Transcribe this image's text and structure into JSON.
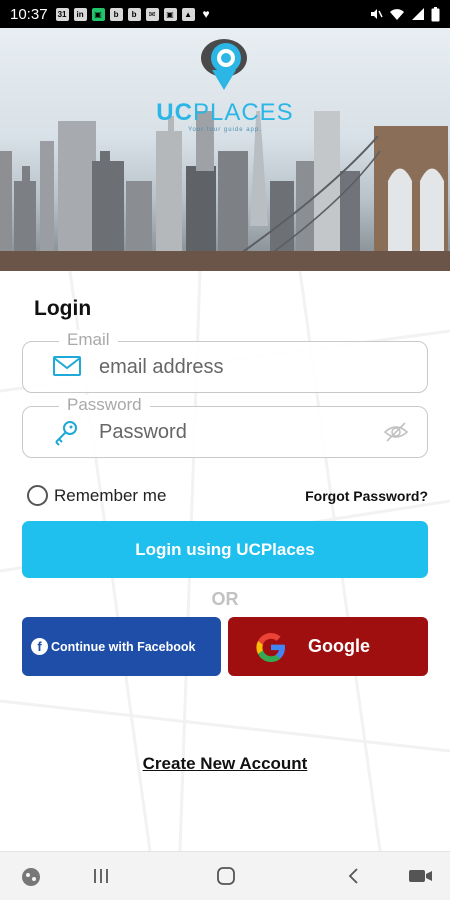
{
  "status_bar": {
    "time": "10:37",
    "notification_icons": [
      "31",
      "in",
      "▣",
      "b",
      "b",
      "✉",
      "▣",
      "▲",
      "♥"
    ]
  },
  "brand": {
    "name_bold": "UC",
    "name_light": "PLACES",
    "tagline": "Your tour guide app.",
    "accent_color": "#1fbfee"
  },
  "login": {
    "title": "Login",
    "email": {
      "legend": "Email",
      "placeholder": "email address",
      "icon": "envelope-icon"
    },
    "password": {
      "legend": "Password",
      "placeholder": "Password",
      "icon": "key-icon",
      "toggle_icon": "eye-off-icon"
    },
    "remember_label": "Remember me",
    "forgot_label": "Forgot Password?",
    "primary_button": "Login using UCPlaces",
    "divider": "OR",
    "facebook_button": "Continue with Facebook",
    "google_button": "Google",
    "create_account": "Create New Account"
  },
  "colors": {
    "facebook": "#1f4ea9",
    "google": "#a00f0f"
  },
  "nav_bar": {
    "icons": [
      "dots-icon",
      "recents-icon",
      "home-icon",
      "back-icon",
      "camera-icon"
    ]
  }
}
